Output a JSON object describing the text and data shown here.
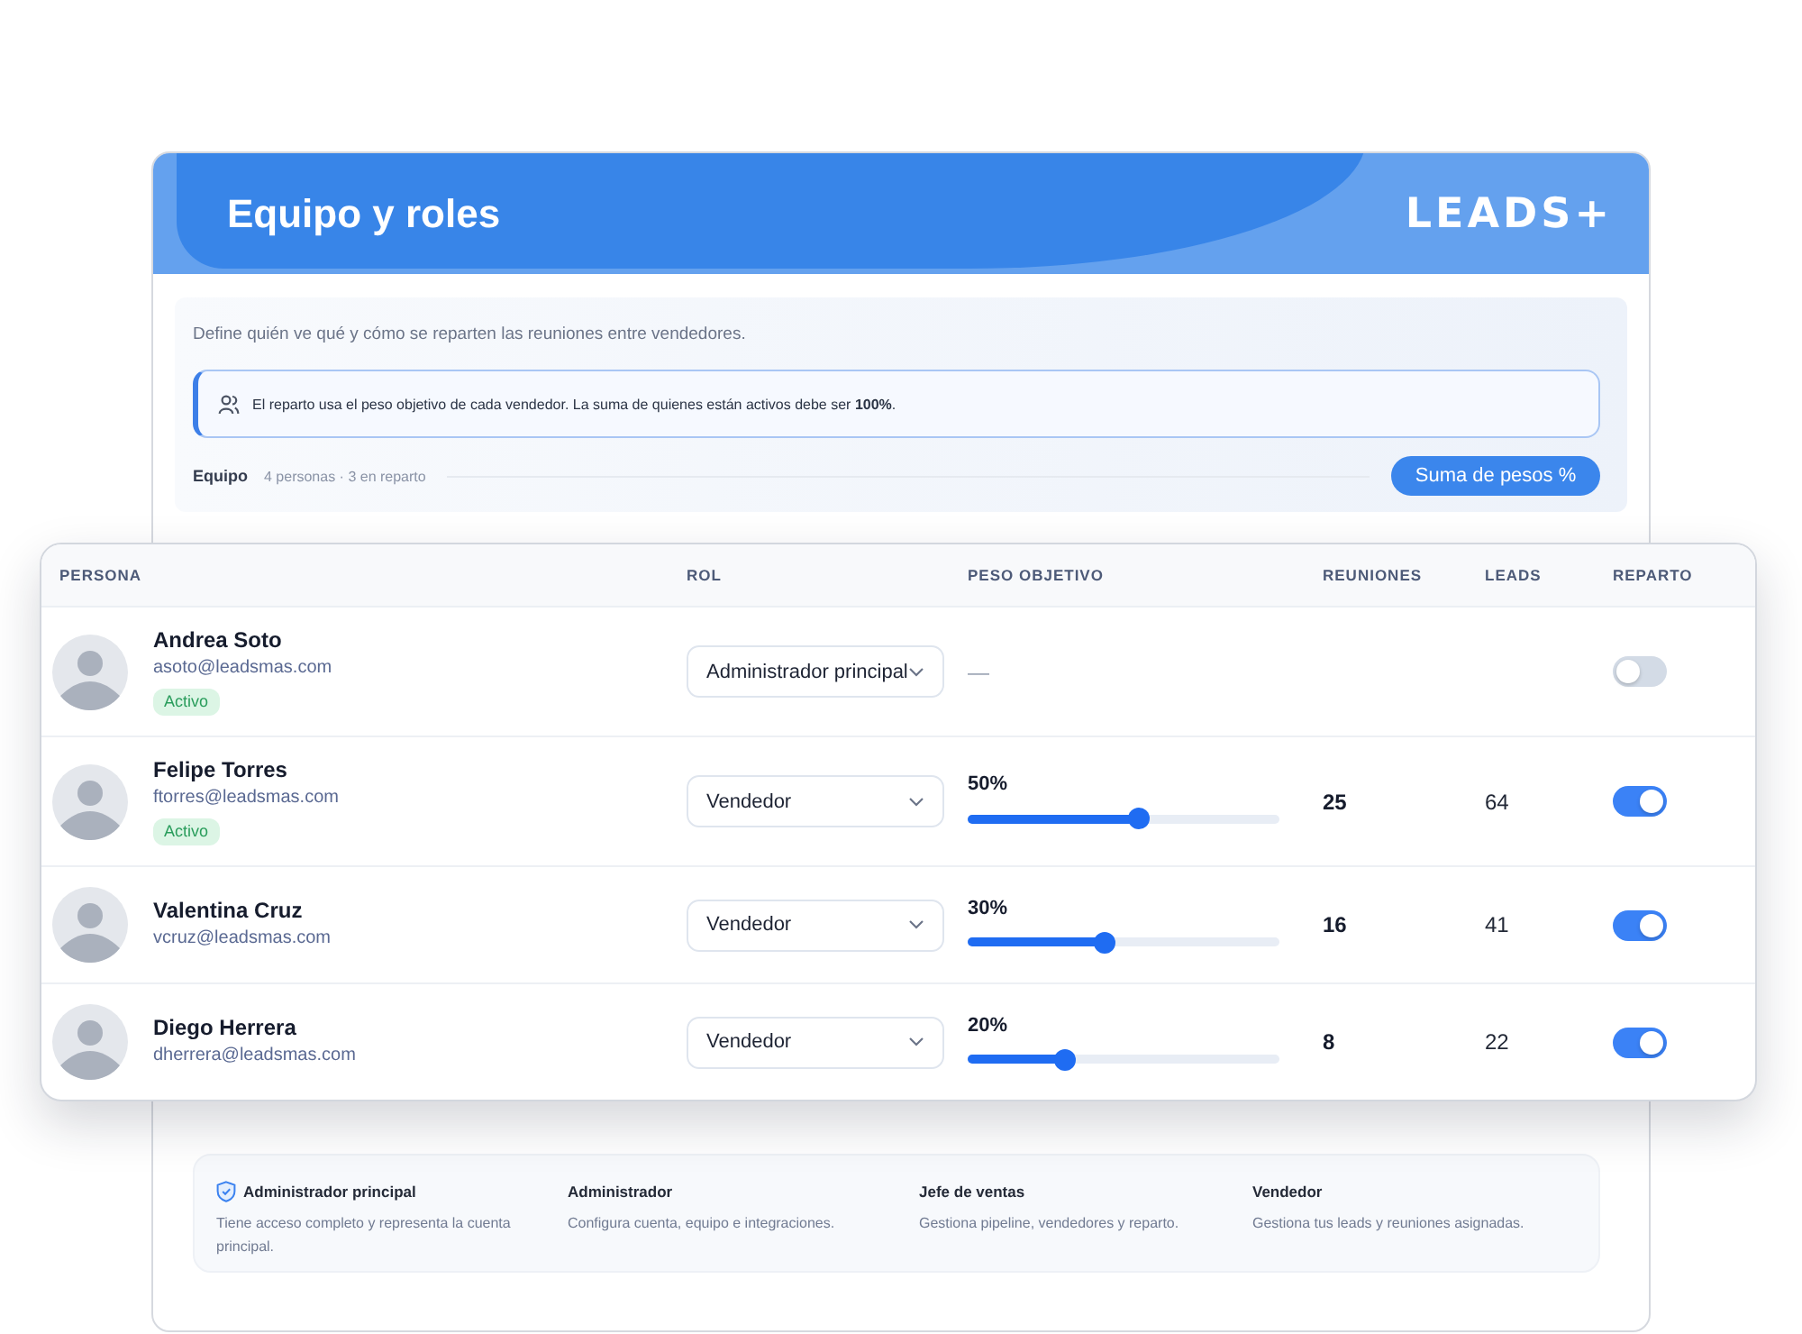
{
  "header": {
    "title": "Equipo y roles",
    "logo": "LEADS+"
  },
  "intro": {
    "description": "Define quién ve qué y cómo se reparten las reuniones entre vendedores.",
    "notice": "El reparto usa el peso objetivo de cada vendedor. La suma de quienes están activos debe ser **100%**.",
    "team_label": "Equipo",
    "team_summary": "4 personas · 3 en reparto",
    "button": "Suma de pesos %"
  },
  "table": {
    "columns": [
      "PERSONA",
      "ROL",
      "PESO OBJETIVO",
      "REUNIONES",
      "LEADS",
      "REPARTO"
    ],
    "rows": [
      {
        "name": "Andrea Soto",
        "email": "asoto@leadsmas.com",
        "badge": "Activo",
        "role": "Administrador principal",
        "kind": "plain",
        "weight": "—",
        "on": false
      },
      {
        "name": "Felipe Torres",
        "email": "ftorres@leadsmas.com",
        "badge": "Activo",
        "role": "Vendedor",
        "kind": "slider",
        "weight": "50%",
        "level": 0.55,
        "meetings": "25",
        "leads": "64",
        "on": true
      },
      {
        "name": "Valentina Cruz",
        "email": "vcruz@leadsmas.com",
        "role": "Vendedor",
        "kind": "slider",
        "weight": "30%",
        "level": 0.44,
        "meetings": "16",
        "leads": "41",
        "on": true
      },
      {
        "name": "Diego Herrera",
        "email": "dherrera@leadsmas.com",
        "role": "Vendedor",
        "kind": "slider",
        "weight": "20%",
        "level": 0.31,
        "meetings": "8",
        "leads": "22",
        "on": true
      }
    ]
  },
  "roles_legend": [
    {
      "kind": "shield",
      "title": "Administrador principal",
      "description": "Tiene acceso completo y representa la cuenta principal."
    },
    {
      "kind": "plain",
      "title": "Administrador",
      "description": "Configura cuenta, equipo e integraciones."
    },
    {
      "kind": "plain",
      "title": "Jefe de ventas",
      "description": "Gestiona pipeline, vendedores y reparto."
    },
    {
      "kind": "plain",
      "title": "Vendedor",
      "description": "Gestiona tus leads y reuniones asignadas."
    }
  ]
}
